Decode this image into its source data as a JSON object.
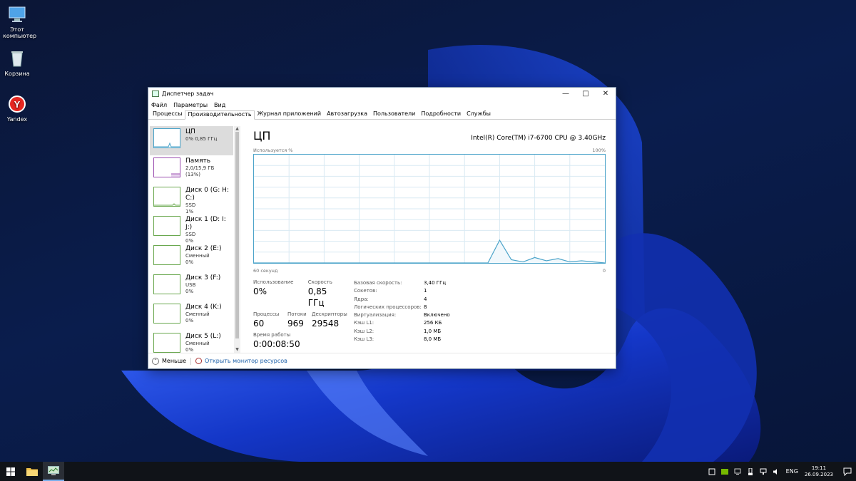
{
  "desktop": {
    "icons": [
      {
        "label": "Этот компьютер",
        "icon": "computer-icon"
      },
      {
        "label": "Корзина",
        "icon": "recycle-bin-icon"
      },
      {
        "label": "Yandex",
        "icon": "yandex-browser-icon"
      }
    ]
  },
  "window": {
    "title": "Диспетчер задач",
    "menu": [
      "Файл",
      "Параметры",
      "Вид"
    ],
    "tabs": [
      "Процессы",
      "Производительность",
      "Журнал приложений",
      "Автозагрузка",
      "Пользователи",
      "Подробности",
      "Службы"
    ],
    "active_tab": 1
  },
  "sidebar": {
    "items": [
      {
        "name": "ЦП",
        "line1": "0% 0,85 ГГц",
        "line2": ""
      },
      {
        "name": "Память",
        "line1": "2,0/15,9 ГБ (13%)",
        "line2": ""
      },
      {
        "name": "Диск 0 (G: H: C:)",
        "line1": "SSD",
        "line2": "1%"
      },
      {
        "name": "Диск 1 (D: I: J:)",
        "line1": "SSD",
        "line2": "0%"
      },
      {
        "name": "Диск 2 (E:)",
        "line1": "Сменный",
        "line2": "0%"
      },
      {
        "name": "Диск 3 (F:)",
        "line1": "USB",
        "line2": "0%"
      },
      {
        "name": "Диск 4 (K:)",
        "line1": "Сменный",
        "line2": "0%"
      },
      {
        "name": "Диск 5 (L:)",
        "line1": "Сменный",
        "line2": "0%"
      }
    ]
  },
  "main": {
    "heading": "ЦП",
    "cpu_name": "Intel(R) Core(TM) i7-6700 CPU @ 3.40GHz",
    "graph_label": "Используется %",
    "graph_max": "100%",
    "graph_time": "60 секунд",
    "graph_min": "0",
    "usage_label": "Использование",
    "usage_value": "0%",
    "speed_label": "Скорость",
    "speed_value": "0,85 ГГц",
    "proc_label": "Процессы",
    "proc_value": "60",
    "threads_label": "Потоки",
    "threads_value": "969",
    "handles_label": "Дескрипторы",
    "handles_value": "29548",
    "uptime_label": "Время работы",
    "uptime_value": "0:00:08:50",
    "specs": [
      {
        "k": "Базовая скорость:",
        "v": "3,40 ГГц"
      },
      {
        "k": "Сокетов:",
        "v": "1"
      },
      {
        "k": "Ядра:",
        "v": "4"
      },
      {
        "k": "Логических процессоров:",
        "v": "8"
      },
      {
        "k": "Виртуализация:",
        "v": "Включено"
      },
      {
        "k": "Кэш L1:",
        "v": "256 КБ"
      },
      {
        "k": "Кэш L2:",
        "v": "1,0 МБ"
      },
      {
        "k": "Кэш L3:",
        "v": "8,0 МБ"
      }
    ]
  },
  "chart_data": {
    "type": "line",
    "x": [
      0,
      2,
      4,
      6,
      8,
      10,
      12,
      14,
      16,
      18,
      20,
      22,
      24,
      26,
      28,
      30,
      32,
      34,
      36,
      38,
      40,
      42,
      44,
      46,
      48,
      50,
      52,
      54,
      56,
      58,
      60
    ],
    "values": [
      0,
      0,
      0,
      0,
      0,
      0,
      0,
      0,
      0,
      0,
      0,
      0,
      0,
      0,
      0,
      0,
      0,
      0,
      0,
      0,
      0,
      0,
      0,
      0,
      0,
      0,
      0,
      0,
      0,
      0,
      0
    ],
    "series_points": [
      0,
      0,
      0,
      0,
      0,
      0,
      0,
      0,
      0,
      0,
      0,
      0,
      0,
      0,
      0,
      0,
      0,
      0,
      0,
      0,
      0,
      21,
      3,
      1,
      5,
      2,
      4,
      1,
      2,
      1,
      0
    ],
    "ylim": [
      0,
      100
    ],
    "xlim": [
      0,
      60
    ],
    "grid": true,
    "color": "#4aa3c9"
  },
  "footer": {
    "less": "Меньше",
    "monitor": "Открыть монитор ресурсов"
  },
  "taskbar": {
    "lang": "ENG",
    "time": "19:11",
    "date": "26.09.2023"
  }
}
